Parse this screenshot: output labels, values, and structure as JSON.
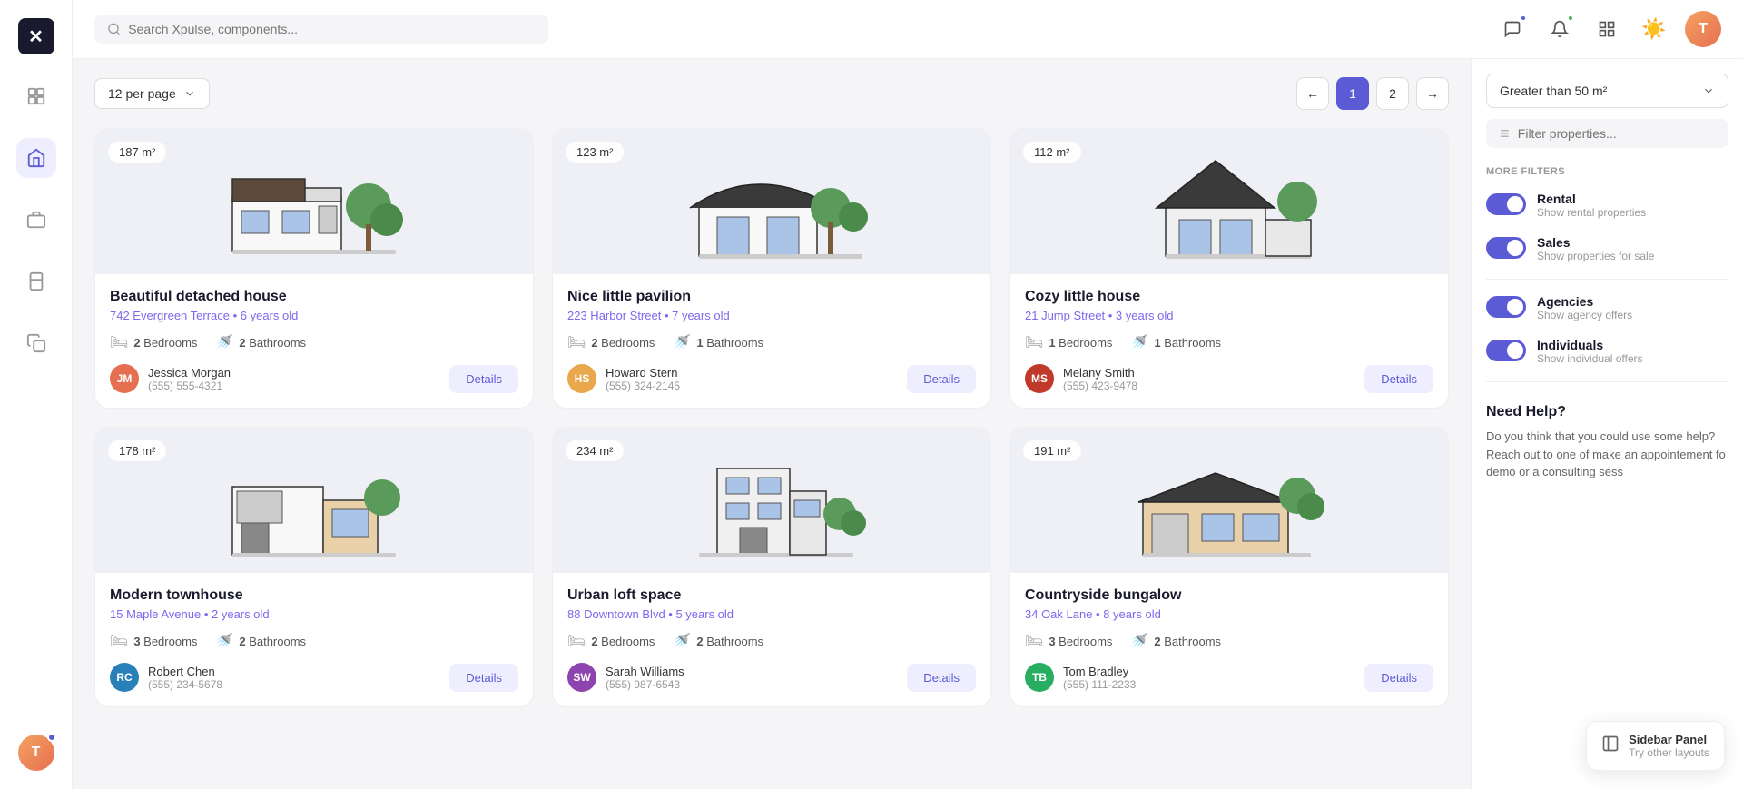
{
  "app": {
    "name": "Xpulse",
    "logo_char": "✕"
  },
  "search": {
    "placeholder": "Search Xpulse, components..."
  },
  "toolbar": {
    "per_page_label": "12 per page",
    "pagination": {
      "prev_label": "←",
      "next_label": "→",
      "current_page": "1",
      "total_pages": "2"
    }
  },
  "filter_sidebar": {
    "area_filter_label": "Greater than 50 m²",
    "filter_search_placeholder": "Filter properties...",
    "more_filters_label": "MORE FILTERS",
    "filters": [
      {
        "id": "rental",
        "name": "Rental",
        "description": "Show rental properties",
        "enabled": true
      },
      {
        "id": "sales",
        "name": "Sales",
        "description": "Show properties for sale",
        "enabled": true
      },
      {
        "id": "agencies",
        "name": "Agencies",
        "description": "Show agency offers",
        "enabled": true
      },
      {
        "id": "individuals",
        "name": "Individuals",
        "description": "Show individual offers",
        "enabled": true
      }
    ],
    "help": {
      "title": "Need Help?",
      "text": "Do you think that you could use some help? Reach out to one of make an appointement fo demo or a consulting sess"
    }
  },
  "sidebar_panel_hint": {
    "icon": "▦",
    "title": "Sidebar Panel",
    "subtitle": "Try other layouts"
  },
  "properties": [
    {
      "id": 1,
      "title": "Beautiful detached house",
      "address": "742 Evergreen Terrace • 6 years old",
      "area": "187 m²",
      "bedrooms": 2,
      "bathrooms": 2,
      "agent_name": "Jessica Morgan",
      "agent_phone": "(555) 555-4321",
      "agent_color": "#e76f51",
      "agent_initials": "JM",
      "house_type": "modern-flat",
      "bg_color": "#eef0f5"
    },
    {
      "id": 2,
      "title": "Nice little pavilion",
      "address": "223 Harbor Street • 7 years old",
      "area": "123 m²",
      "bedrooms": 2,
      "bathrooms": 1,
      "agent_name": "Howard Stern",
      "agent_phone": "(555) 324-2145",
      "agent_color": "#e9a84c",
      "agent_initials": "HS",
      "house_type": "curved-roof",
      "bg_color": "#eef0f5"
    },
    {
      "id": 3,
      "title": "Cozy little house",
      "address": "21 Jump Street • 3 years old",
      "area": "112 m²",
      "bedrooms": 1,
      "bathrooms": 1,
      "agent_name": "Melany Smith",
      "agent_phone": "(555) 423-9478",
      "agent_color": "#c0392b",
      "agent_initials": "MS",
      "house_type": "tall-roof",
      "bg_color": "#eef0f5"
    },
    {
      "id": 4,
      "title": "Modern townhouse",
      "address": "15 Maple Avenue • 2 years old",
      "area": "178 m²",
      "bedrooms": 3,
      "bathrooms": 2,
      "agent_name": "Robert Chen",
      "agent_phone": "(555) 234-5678",
      "agent_color": "#2980b9",
      "agent_initials": "RC",
      "house_type": "box-modern",
      "bg_color": "#eef0f5"
    },
    {
      "id": 5,
      "title": "Urban loft space",
      "address": "88 Downtown Blvd • 5 years old",
      "area": "234 m²",
      "bedrooms": 2,
      "bathrooms": 2,
      "agent_name": "Sarah Williams",
      "agent_phone": "(555) 987-6543",
      "agent_color": "#8e44ad",
      "agent_initials": "SW",
      "house_type": "urban-tall",
      "bg_color": "#eef0f5"
    },
    {
      "id": 6,
      "title": "Countryside bungalow",
      "address": "34 Oak Lane • 8 years old",
      "area": "191 m²",
      "bedrooms": 3,
      "bathrooms": 2,
      "agent_name": "Tom Bradley",
      "agent_phone": "(555) 111-2233",
      "agent_color": "#27ae60",
      "agent_initials": "TB",
      "house_type": "wide-bungalow",
      "bg_color": "#eef0f5"
    }
  ],
  "nav_icons": [
    {
      "id": "dashboard",
      "symbol": "⊞",
      "active": false
    },
    {
      "id": "grid",
      "symbol": "▦",
      "active": true
    },
    {
      "id": "briefcase",
      "symbol": "💼",
      "active": false
    },
    {
      "id": "layers",
      "symbol": "◧",
      "active": false
    },
    {
      "id": "copy",
      "symbol": "⧉",
      "active": false
    }
  ]
}
